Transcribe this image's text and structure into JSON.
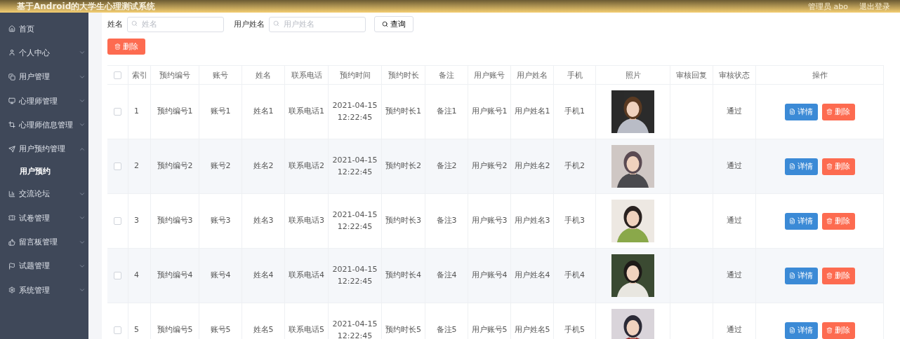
{
  "header": {
    "title": "基于Android的大学生心理测试系统",
    "user": "管理员 abo",
    "logout": "退出登录"
  },
  "sidebar": {
    "items": [
      {
        "label": "首页",
        "selected": false
      },
      {
        "label": "个人中心",
        "expanded": false,
        "selected": false
      },
      {
        "label": "用户管理",
        "expanded": false,
        "selected": false
      },
      {
        "label": "心理师管理",
        "expanded": false,
        "selected": false
      },
      {
        "label": "心理师信息管理",
        "expanded": false,
        "selected": false
      },
      {
        "label": "用户预约管理",
        "expanded": true,
        "selected": false,
        "children": [
          {
            "label": "用户预约",
            "selected": true
          }
        ]
      },
      {
        "label": "交流论坛",
        "expanded": false,
        "selected": false
      },
      {
        "label": "试卷管理",
        "expanded": false,
        "selected": false
      },
      {
        "label": "留言板管理",
        "expanded": false,
        "selected": false
      },
      {
        "label": "试题管理",
        "expanded": false,
        "selected": false
      },
      {
        "label": "系统管理",
        "expanded": false,
        "selected": false
      }
    ]
  },
  "search": {
    "fields": [
      {
        "label": "姓名",
        "placeholder": "姓名"
      },
      {
        "label": "用户姓名",
        "placeholder": "用户姓名"
      }
    ],
    "button": "查询"
  },
  "delete_button": "删除",
  "table": {
    "all_checked": false,
    "columns": [
      "索引",
      "预约编号",
      "账号",
      "姓名",
      "联系电话",
      "预约时间",
      "预约时长",
      "备注",
      "用户账号",
      "用户姓名",
      "手机",
      "照片",
      "审核回复",
      "审核状态",
      "操作"
    ],
    "rows": [
      {
        "checked": false,
        "cells": [
          "1",
          "预约编号1",
          "账号1",
          "姓名1",
          "联系电话1",
          "2021-04-15 12:22:45",
          "预约时长1",
          "备注1",
          "用户账号1",
          "用户姓名1",
          "手机1"
        ],
        "status": "通过",
        "actions": [
          "详情",
          "删除"
        ]
      },
      {
        "checked": false,
        "cells": [
          "2",
          "预约编号2",
          "账号2",
          "姓名2",
          "联系电话2",
          "2021-04-15 12:22:45",
          "预约时长2",
          "备注2",
          "用户账号2",
          "用户姓名2",
          "手机2"
        ],
        "status": "通过",
        "actions": [
          "详情",
          "删除"
        ]
      },
      {
        "checked": false,
        "cells": [
          "3",
          "预约编号3",
          "账号3",
          "姓名3",
          "联系电话3",
          "2021-04-15 12:22:45",
          "预约时长3",
          "备注3",
          "用户账号3",
          "用户姓名3",
          "手机3"
        ],
        "status": "通过",
        "actions": [
          "详情",
          "删除"
        ]
      },
      {
        "checked": false,
        "cells": [
          "4",
          "预约编号4",
          "账号4",
          "姓名4",
          "联系电话4",
          "2021-04-15 12:22:45",
          "预约时长4",
          "备注4",
          "用户账号4",
          "用户姓名4",
          "手机4"
        ],
        "status": "通过",
        "actions": [
          "详情",
          "删除"
        ]
      },
      {
        "checked": false,
        "cells": [
          "5",
          "预约编号5",
          "账号5",
          "姓名5",
          "联系电话5",
          "2021-04-15 12:22:45",
          "预约时长5",
          "备注5",
          "用户账号5",
          "用户姓名5",
          "手机5"
        ],
        "status": "通过",
        "actions": [
          "详情",
          "删除"
        ]
      }
    ]
  }
}
